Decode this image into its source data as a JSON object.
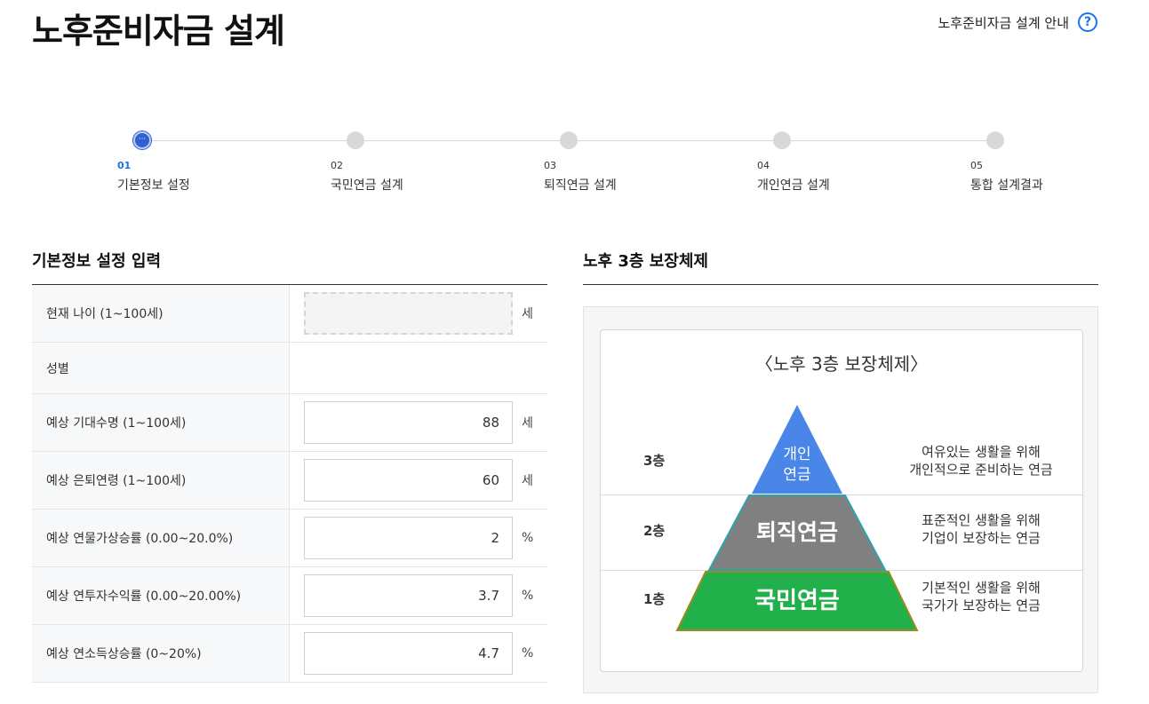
{
  "header": {
    "title": "노후준비자금 설계",
    "guide_label": "노후준비자금 설계 안내",
    "help_icon": "?"
  },
  "stepper": {
    "active_dot": "···",
    "steps": [
      {
        "num": "01",
        "label": "기본정보 설정"
      },
      {
        "num": "02",
        "label": "국민연금 설계"
      },
      {
        "num": "03",
        "label": "퇴직연금 설계"
      },
      {
        "num": "04",
        "label": "개인연금 설계"
      },
      {
        "num": "05",
        "label": "통합 설계결과"
      }
    ]
  },
  "form": {
    "title": "기본정보 설정 입력",
    "rows": [
      {
        "label": "현재 나이 (1~100세)",
        "value": "",
        "unit": "세"
      },
      {
        "label": "성별"
      },
      {
        "label": "예상 기대수명 (1~100세)",
        "value": "88",
        "unit": "세"
      },
      {
        "label": "예상 은퇴연령 (1~100세)",
        "value": "60",
        "unit": "세"
      },
      {
        "label": "예상 연물가상승률 (0.00~20.0%)",
        "value": "2",
        "unit": "%"
      },
      {
        "label": "예상 연투자수익률 (0.00~20.00%)",
        "value": "3.7",
        "unit": "%"
      },
      {
        "label": "예상 연소득상승률 (0~20%)",
        "value": "4.7",
        "unit": "%"
      }
    ]
  },
  "pyramid": {
    "section_title": "노후 3층 보장체제",
    "title": "〈노후 3층 보장체제〉",
    "tiers": [
      {
        "floor": "3층",
        "name_line1": "개인",
        "name_line2": "연금",
        "desc_line1": "여유있는 생활을 위해",
        "desc_line2": "개인적으로 준비하는 연금",
        "color": "#4a86e8"
      },
      {
        "floor": "2층",
        "name": "퇴직연금",
        "desc_line1": "표준적인 생활을 위해",
        "desc_line2": "기업이 보장하는 연금",
        "color": "#808080"
      },
      {
        "floor": "1층",
        "name": "국민연금",
        "desc_line1": "기본적인 생활을 위해",
        "desc_line2": "국가가 보장하는 연금",
        "color": "#22b04b"
      }
    ]
  }
}
